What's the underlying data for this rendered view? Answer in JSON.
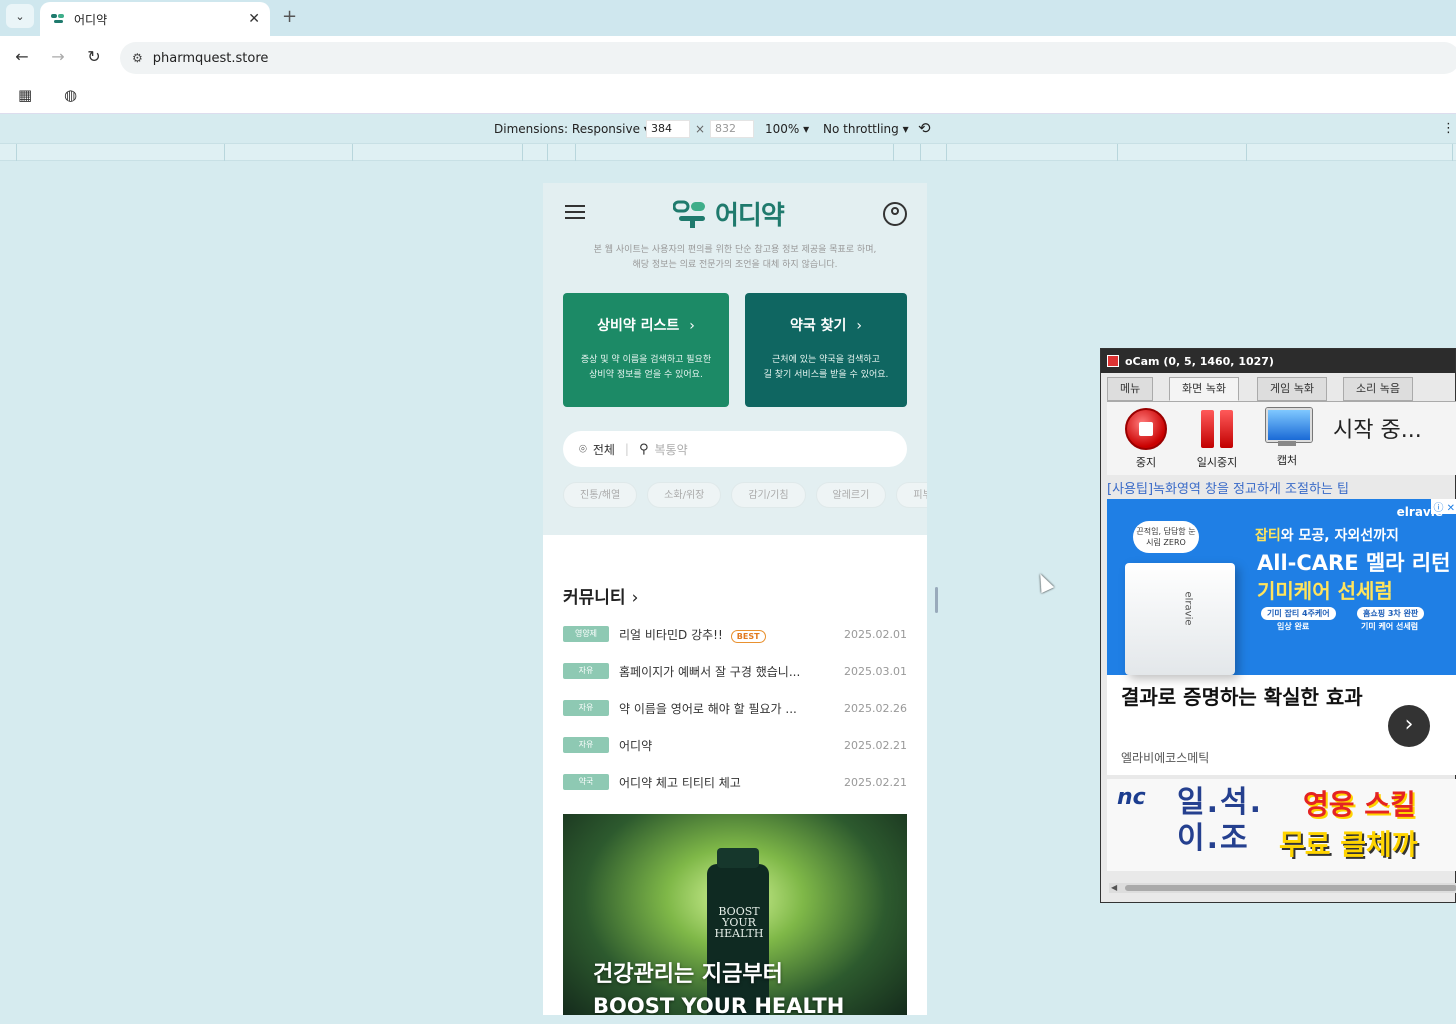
{
  "browser": {
    "tab_title": "어디약",
    "tab_close": "✕",
    "new_tab": "+",
    "url": "pharmquest.store"
  },
  "devtools": {
    "dimensions_label": "Dimensions: Responsive ▾",
    "width": "384",
    "times": "×",
    "height": "832",
    "zoom": "100% ▾",
    "throttling": "No throttling ▾"
  },
  "app": {
    "logo_text": "어디약",
    "disclaimer_line1": "본 웹 사이트는 사용자의 편의를 위한 단순 참고용 정보 제공을 목표로 하며,",
    "disclaimer_line2": "해당 정보는 의료 전문가의 조언을 대체 하지 않습니다.",
    "cards": [
      {
        "title": "상비약 리스트",
        "desc1": "증상 및 약 이름을 검색하고 필요한",
        "desc2": "상비약 정보를 얻을 수 있어요."
      },
      {
        "title": "약국 찾기",
        "desc1": "근처에 있는 약국을 검색하고",
        "desc2": "길 찾기 서비스를 받을 수 있어요."
      }
    ],
    "search": {
      "region": "전체",
      "placeholder": "복통약"
    },
    "chips": [
      "진통/해열",
      "소화/위장",
      "감기/기침",
      "알레르기",
      "피부"
    ],
    "community_title": "커뮤니티",
    "posts": [
      {
        "badge": "영양제",
        "title": "리얼 비타민D 강추!!",
        "best": "BEST",
        "date": "2025.02.01"
      },
      {
        "badge": "자유",
        "title": "홈페이지가 예뻐서 잘 구경 했습니...",
        "date": "2025.03.01"
      },
      {
        "badge": "자유",
        "title": "약 이름을 영어로 해야 할 필요가 ...",
        "date": "2025.02.26"
      },
      {
        "badge": "자유",
        "title": "어디약",
        "date": "2025.02.21"
      },
      {
        "badge": "약국",
        "title": "어디약 체고 티티티 체고",
        "date": "2025.02.21"
      }
    ],
    "banner": {
      "bottle_text": "BOOST YOUR HEALTH",
      "headline": "건강관리는 지금부터",
      "headline2": "BOOST YOUR HEALTH"
    }
  },
  "ocam": {
    "title": "oCam (0, 5, 1460, 1027)",
    "tabs": [
      "메뉴",
      "화면 녹화",
      "게임 녹화",
      "소리 녹음"
    ],
    "tools": [
      "중지",
      "일시중지",
      "캡처"
    ],
    "status": "시작 중...",
    "tip": "[사용팁]녹화영역 창을 정교하게 조절하는 팁"
  },
  "ad1": {
    "bubble": "끈적임, 답답함 눈시림 ZERO",
    "brand": "elravie",
    "ad_marks": "ⓘ ✕",
    "product_label": "elravie",
    "line1_a": "잡티",
    "line1_b": "와 모공, 자외선까지",
    "line2": "All-CARE 멜라 리턴",
    "line3": "기미케어 선세럼",
    "pill1": "기미 잡티 4주케어",
    "pill1_sub": "임상 완료",
    "pill2": "홈쇼핑 3차 완판",
    "pill2_sub": "기미 케어 선세럼",
    "headline": "결과로 증명하는 확실한 효과",
    "advertiser": "엘라비에코스메틱",
    "go": "›"
  },
  "ad2": {
    "logo": "nc",
    "left": "일.석.\n이.조",
    "right1": "영웅 스킬",
    "right2": "무료 클체까"
  },
  "colors": {
    "card_green": "#1c8a66",
    "card_teal": "#0f6661",
    "logo": "#1f7a6d",
    "best": "#e27a1f"
  }
}
